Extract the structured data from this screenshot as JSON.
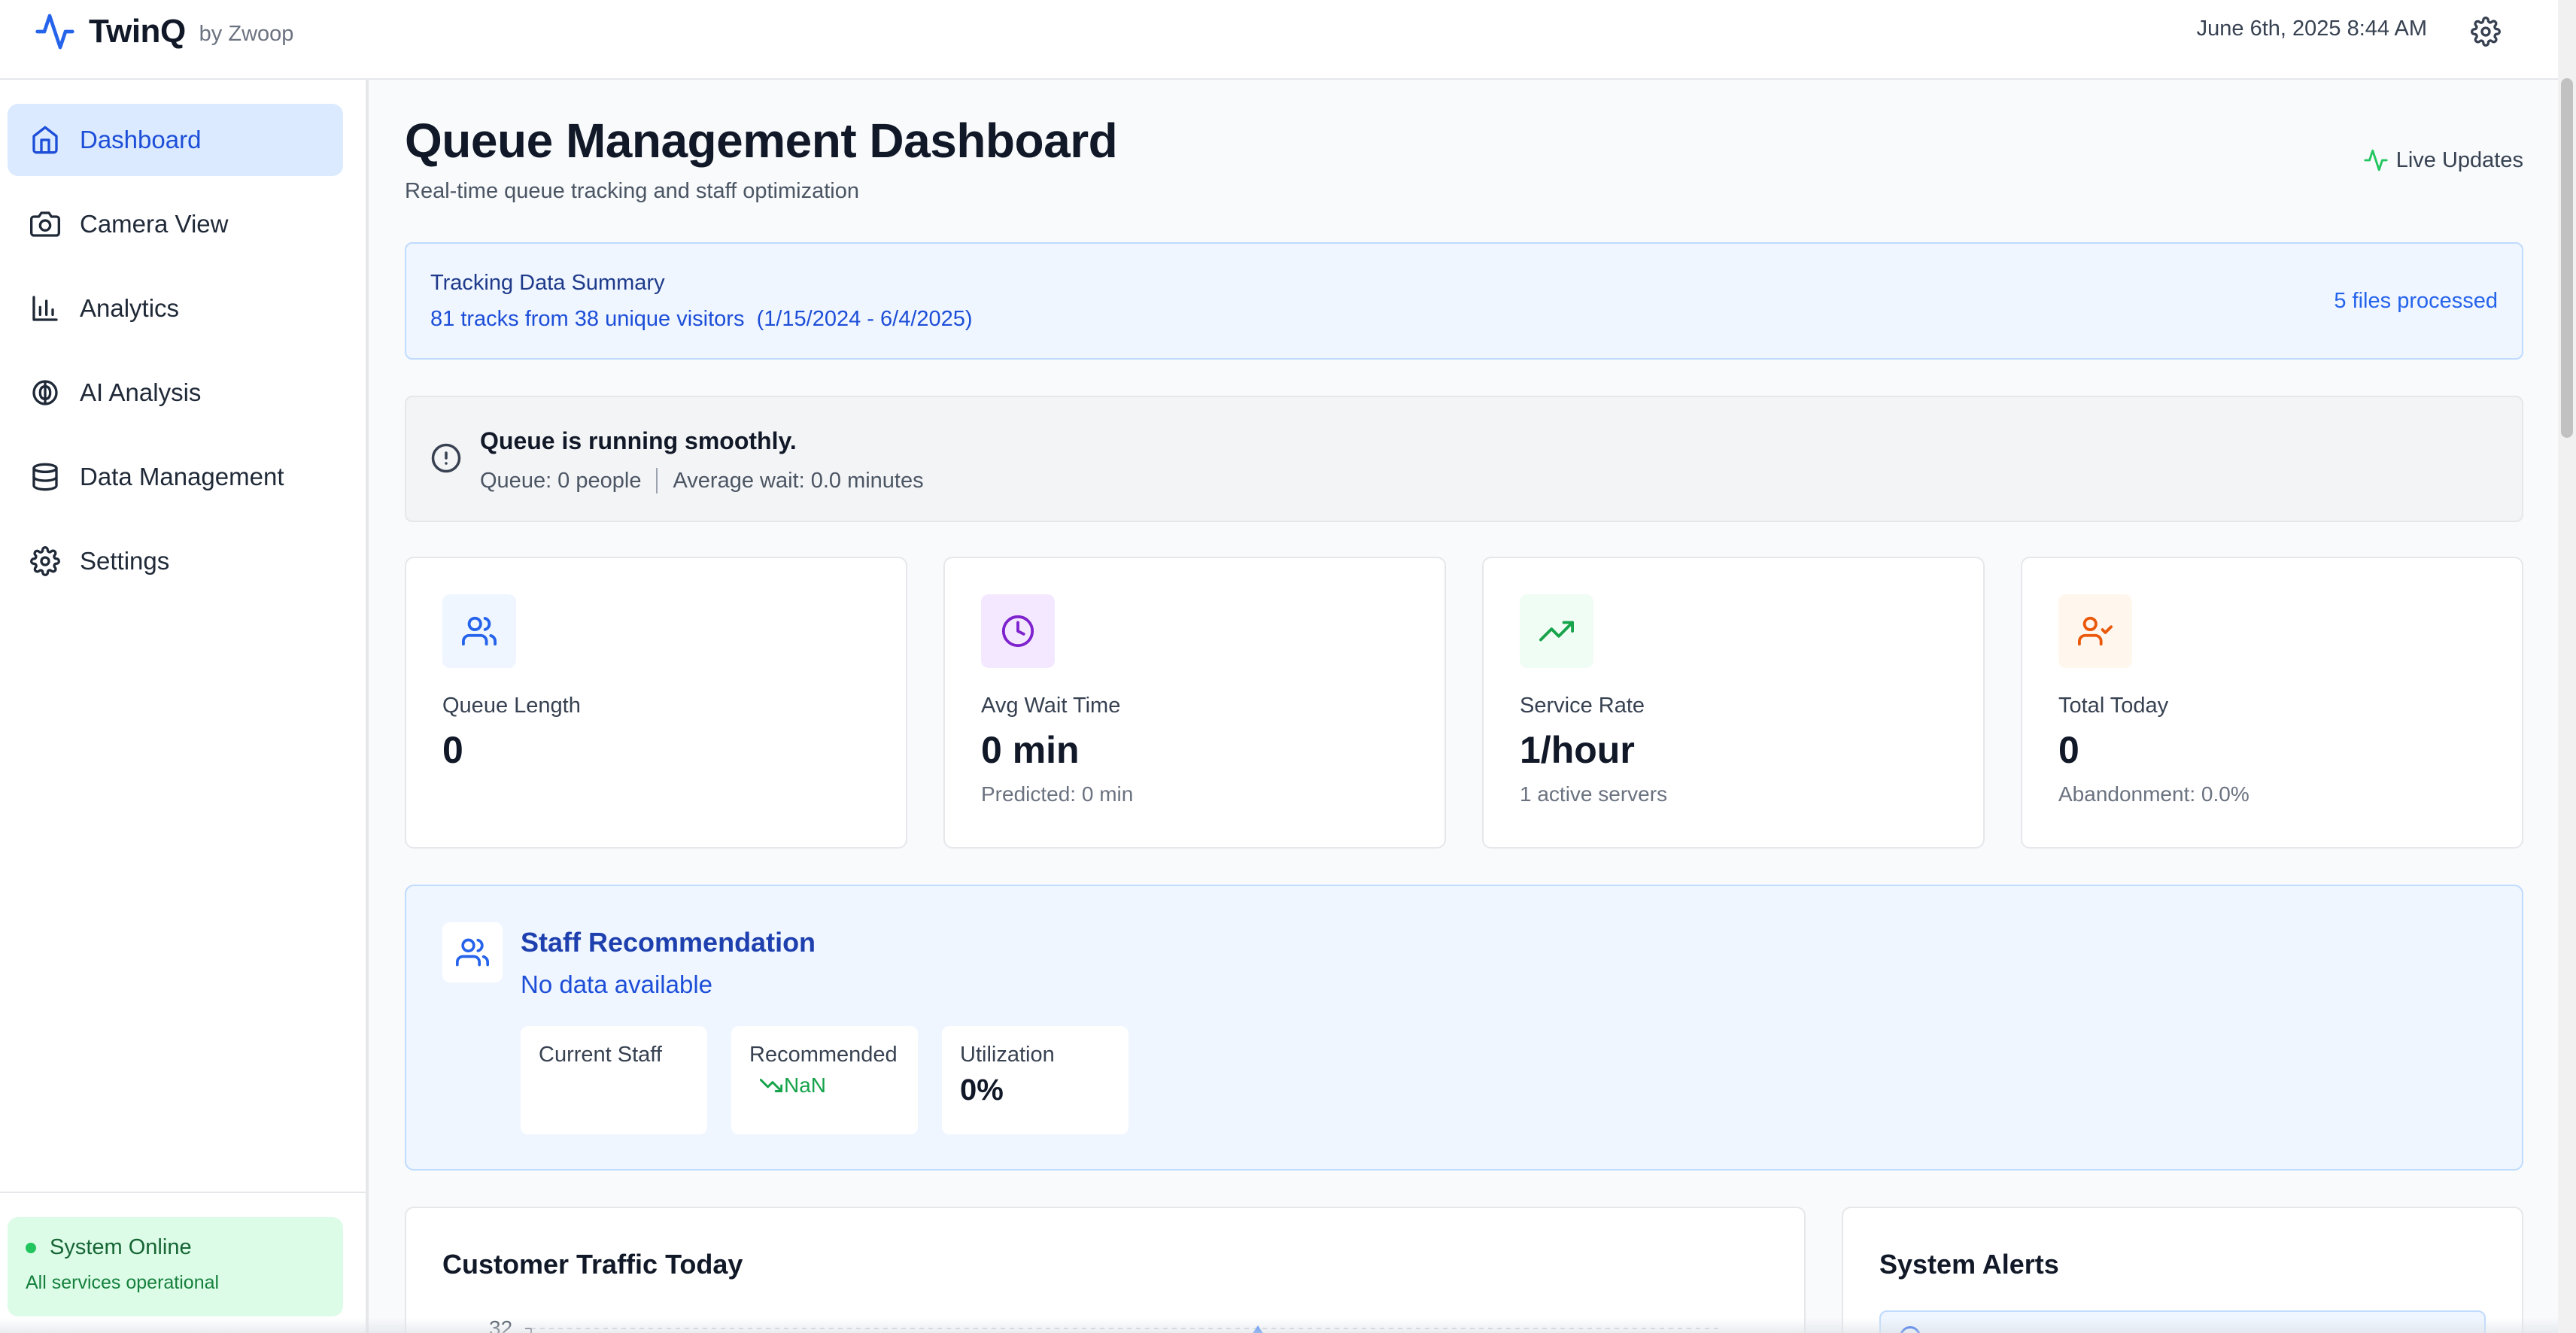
{
  "app": {
    "name": "TwinQ",
    "byline": "by Zwoop",
    "datetime": "June 6th, 2025 8:44 AM",
    "accent_color": "#2563eb"
  },
  "sidebar": {
    "items": [
      {
        "label": "Dashboard",
        "icon": "home-icon",
        "active": true
      },
      {
        "label": "Camera View",
        "icon": "camera-icon",
        "active": false
      },
      {
        "label": "Analytics",
        "icon": "bar-chart-icon",
        "active": false
      },
      {
        "label": "AI Analysis",
        "icon": "brain-icon",
        "active": false
      },
      {
        "label": "Data Management",
        "icon": "database-icon",
        "active": false
      },
      {
        "label": "Settings",
        "icon": "gear-icon",
        "active": false
      }
    ],
    "status": {
      "title": "System Online",
      "subtitle": "All services operational",
      "color": "#22c55e"
    }
  },
  "main": {
    "title": "Queue Management Dashboard",
    "subtitle": "Real-time queue tracking and staff optimization",
    "live_label": "Live Updates",
    "summary": {
      "title": "Tracking Data Summary",
      "text": "81 tracks from 38 unique visitors  (1/15/2024 - 6/4/2025)",
      "files": "5 files processed"
    },
    "notice": {
      "title": "Queue is running smoothly.",
      "queue": "Queue: 0 people",
      "wait": "Average wait: 0.0 minutes"
    },
    "metrics": [
      {
        "label": "Queue Length",
        "value": "0",
        "sub": "",
        "icon": "users-icon",
        "icon_color": "#2563eb",
        "icon_bg": "#eff6ff"
      },
      {
        "label": "Avg Wait Time",
        "value": "0 min",
        "sub": "Predicted: 0 min",
        "icon": "clock-icon",
        "icon_color": "#7e22ce",
        "icon_bg": "#f3e8ff"
      },
      {
        "label": "Service Rate",
        "value": "1/hour",
        "sub": "1 active servers",
        "icon": "trending-up-icon",
        "icon_color": "#16a34a",
        "icon_bg": "#f0fdf4"
      },
      {
        "label": "Total Today",
        "value": "0",
        "sub": "Abandonment: 0.0%",
        "icon": "user-check-icon",
        "icon_color": "#ea580c",
        "icon_bg": "#fff7ed"
      }
    ],
    "staff": {
      "title": "Staff Recommendation",
      "status": "No data available",
      "current_label": "Current Staff",
      "current_value": "",
      "recommended_label": "Recommended",
      "recommended_value": "NaN",
      "utilization_label": "Utilization",
      "utilization_value": "0%"
    },
    "traffic": {
      "title": "Customer Traffic Today",
      "first_tick": "32"
    },
    "alerts": {
      "title": "System Alerts"
    }
  }
}
